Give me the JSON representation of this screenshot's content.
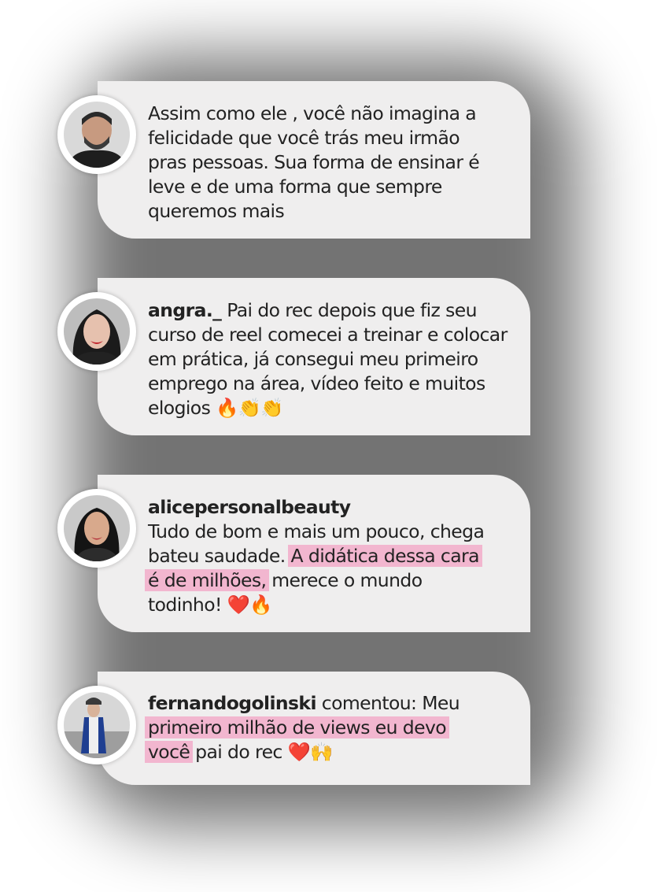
{
  "comments": [
    {
      "username": "",
      "lines": [
        "Assim como ele , você não imagina a",
        "felicidade que você trás meu irmão",
        "pras pessoas. Sua forma de ensinar é",
        "leve e de uma forma que sempre",
        "queremos mais"
      ],
      "avatar_icon": "man-avatar-photo"
    },
    {
      "username": "angra._",
      "line1_rest": "Pai do rec depois que fiz seu",
      "lines": [
        "curso de reel comecei a treinar e colocar",
        "em prática, já consegui meu primeiro",
        "emprego na área, vídeo feito e muitos"
      ],
      "last_line": "elogios",
      "emojis": "🔥👏👏",
      "avatar_icon": "woman-avatar-photo"
    },
    {
      "username": "alicepersonalbeauty",
      "line1": "Tudo de bom e mais um pouco, chega",
      "line2_plain": "bateu saudade.",
      "line2_highlight": "A didática dessa cara",
      "line3_highlight": "é de milhões,",
      "line3_plain": "merece o mundo",
      "line4_plain": "todinho!",
      "emojis": "❤️🔥",
      "avatar_icon": "woman-avatar-photo"
    },
    {
      "username": "fernandogolinski",
      "line1_rest": "comentou: Meu",
      "line2_highlight": "primeiro milhão de views eu devo",
      "line3_highlight": "você",
      "line3_plain": "pai do rec",
      "emojis": "❤️🙌",
      "avatar_icon": "man-avatar-photo"
    }
  ],
  "colors": {
    "card_bg": "#efeeee",
    "highlight": "#f2b6cf",
    "text": "#222222"
  }
}
